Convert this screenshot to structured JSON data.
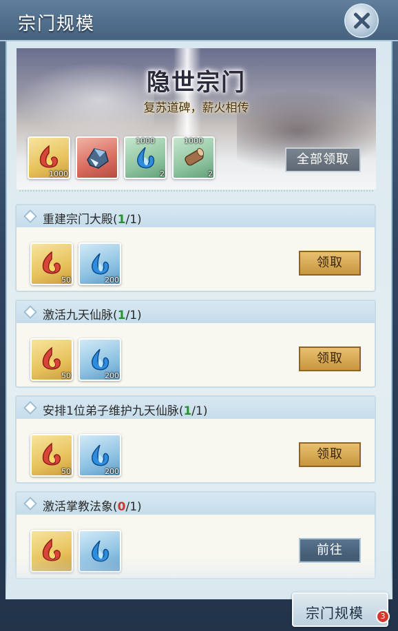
{
  "window": {
    "title": "宗门规模"
  },
  "banner": {
    "title": "隐世宗门",
    "subtitle": "复苏道碑，薪火相传",
    "rewards": [
      {
        "icon": "flame-gem-icon",
        "quantity": "1000",
        "top_quantity": ""
      },
      {
        "icon": "ore-crystal-icon",
        "quantity": "",
        "top_quantity": ""
      },
      {
        "icon": "blue-spirit-flame-icon",
        "quantity": "2",
        "top_quantity": "1000"
      },
      {
        "icon": "wood-log-icon",
        "quantity": "2",
        "top_quantity": "1000"
      }
    ],
    "claim_all_label": "全部领取"
  },
  "tasks": [
    {
      "name": "重建宗门大殿(",
      "progress_done": "1",
      "progress_total": "/1)",
      "done": true,
      "rewards": [
        {
          "icon": "flame-gem-icon",
          "quantity": "50"
        },
        {
          "icon": "blue-spirit-flame-icon",
          "quantity": "200"
        }
      ],
      "button_label": "领取"
    },
    {
      "name": "激活九天仙脉(",
      "progress_done": "1",
      "progress_total": "/1)",
      "done": true,
      "rewards": [
        {
          "icon": "flame-gem-icon",
          "quantity": "50"
        },
        {
          "icon": "blue-spirit-flame-icon",
          "quantity": "200"
        }
      ],
      "button_label": "领取"
    },
    {
      "name": "安排1位弟子维护九天仙脉(",
      "progress_done": "1",
      "progress_total": "/1)",
      "done": true,
      "rewards": [
        {
          "icon": "flame-gem-icon",
          "quantity": "50"
        },
        {
          "icon": "blue-spirit-flame-icon",
          "quantity": "200"
        }
      ],
      "button_label": "领取"
    },
    {
      "name": "激活掌教法象(",
      "progress_done": "0",
      "progress_total": "/1)",
      "done": false,
      "rewards": [
        {
          "icon": "flame-gem-icon",
          "quantity": ""
        },
        {
          "icon": "blue-spirit-flame-icon",
          "quantity": ""
        }
      ],
      "button_label": "前往"
    }
  ],
  "bottom_tab": {
    "label": "宗门规模",
    "badge_count": "3"
  },
  "colors": {
    "progress_done": "#2b8f33",
    "progress_pending": "#c8392d",
    "claim_button": "#c8963e",
    "goto_button": "#3e566e"
  }
}
